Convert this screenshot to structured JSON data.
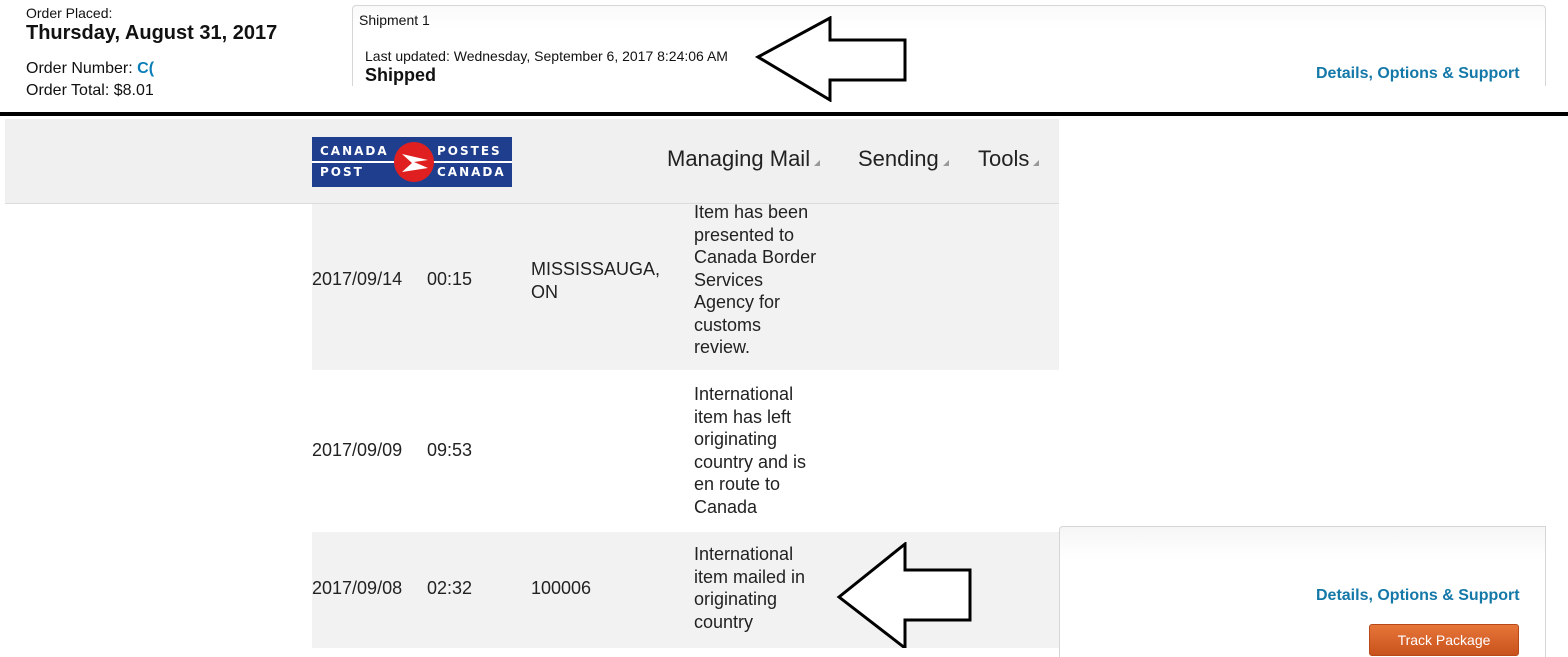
{
  "order": {
    "placed_label": "Order Placed:",
    "placed_date": "Thursday, August 31, 2017",
    "number_label": "Order Number:",
    "number_value": "C(",
    "total_label": "Order Total:",
    "total_value": "$8.01"
  },
  "shipment": {
    "title": "Shipment 1",
    "last_updated": "Last updated: Wednesday, September 6, 2017 8:24:06 AM",
    "status": "Shipped",
    "details_link": "Details, Options & Support"
  },
  "canada_post": {
    "logo": {
      "line1_left": "CANADA",
      "line2_left": "POST",
      "line1_right": "POSTES",
      "line2_right": "CANADA"
    },
    "nav": [
      "Managing Mail",
      "Sending",
      "Tools"
    ],
    "tracking_rows": [
      {
        "date": "2017/09/14",
        "time": "00:15",
        "location_lines": [
          "MISSISSAUGA,",
          "ON"
        ],
        "description_lines": [
          "Item has been",
          "presented to",
          "Canada Border",
          "Services",
          "Agency for",
          "customs",
          "review."
        ]
      },
      {
        "date": "2017/09/09",
        "time": "09:53",
        "location_lines": [],
        "description_lines": [
          "International",
          "item has left",
          "originating",
          "country and is",
          "en route to",
          "Canada"
        ]
      },
      {
        "date": "2017/09/08",
        "time": "02:32",
        "location_lines": [
          "100006"
        ],
        "description_lines": [
          "International",
          "item mailed in",
          "originating",
          "country"
        ]
      }
    ]
  },
  "shipment_lower": {
    "details_link": "Details, Options & Support",
    "track_button": "Track Package"
  },
  "colors": {
    "link": "#1478a8",
    "canada_post_blue": "#1f3f8e",
    "canada_post_red": "#e02020",
    "track_button": "#d7622a"
  }
}
